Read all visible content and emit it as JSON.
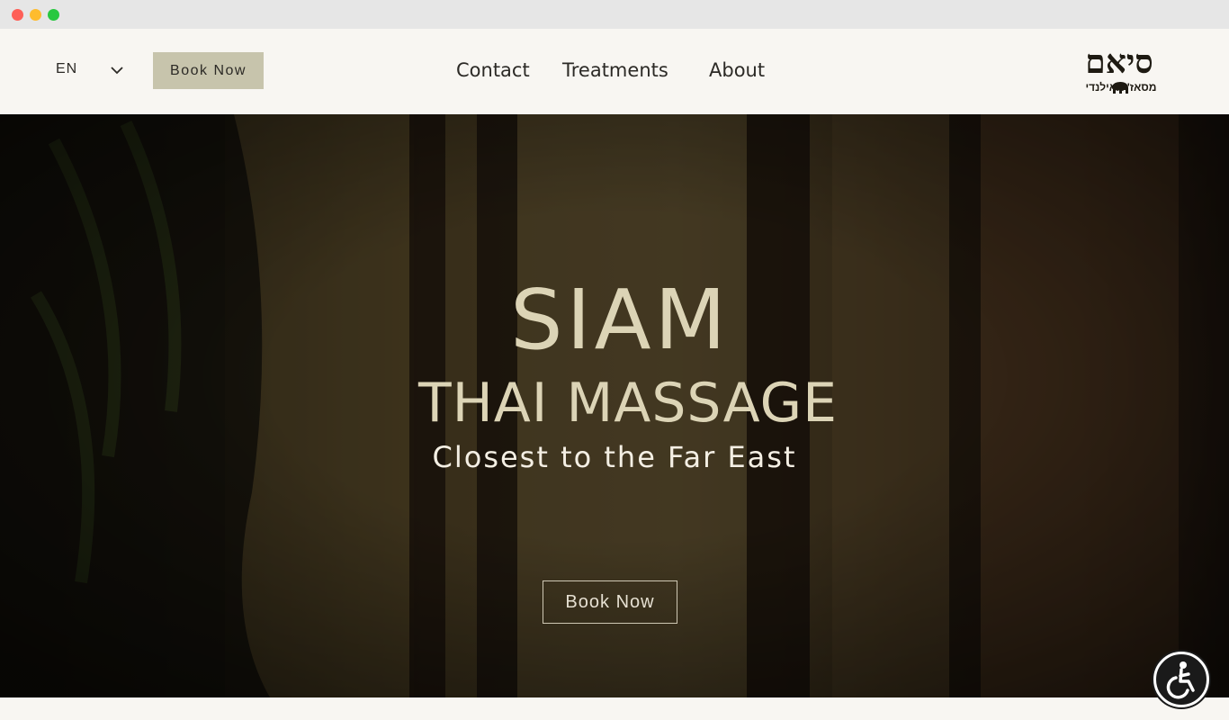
{
  "header": {
    "language": "EN",
    "book_button": "Book Now",
    "nav": [
      {
        "label": "Contact"
      },
      {
        "label": "Treatments"
      },
      {
        "label": "About"
      }
    ],
    "logo": {
      "main": "סיאם",
      "sub": "מסאז' תאילנדי"
    }
  },
  "hero": {
    "title": "SIAM",
    "subtitle": "THAI MASSAGE",
    "tagline": "Closest to the Far East",
    "book_button": "Book Now"
  },
  "colors": {
    "accent": "#c7c4ac",
    "hero_text": "#dcd4b6",
    "background": "#f8f6f2"
  },
  "icons": {
    "language_dropdown": "chevron-down-icon",
    "accessibility": "accessibility-icon",
    "logo_mark": "elephant-icon"
  }
}
